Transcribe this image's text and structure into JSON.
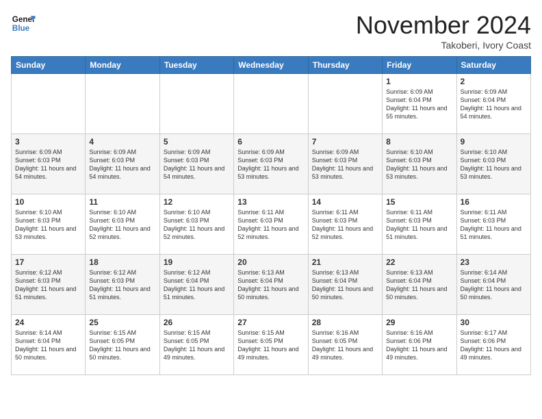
{
  "header": {
    "logo_line1": "General",
    "logo_line2": "Blue",
    "month": "November 2024",
    "location": "Takoberi, Ivory Coast"
  },
  "days_of_week": [
    "Sunday",
    "Monday",
    "Tuesday",
    "Wednesday",
    "Thursday",
    "Friday",
    "Saturday"
  ],
  "weeks": [
    [
      {
        "day": "",
        "info": ""
      },
      {
        "day": "",
        "info": ""
      },
      {
        "day": "",
        "info": ""
      },
      {
        "day": "",
        "info": ""
      },
      {
        "day": "",
        "info": ""
      },
      {
        "day": "1",
        "info": "Sunrise: 6:09 AM\nSunset: 6:04 PM\nDaylight: 11 hours and 55 minutes."
      },
      {
        "day": "2",
        "info": "Sunrise: 6:09 AM\nSunset: 6:04 PM\nDaylight: 11 hours and 54 minutes."
      }
    ],
    [
      {
        "day": "3",
        "info": "Sunrise: 6:09 AM\nSunset: 6:03 PM\nDaylight: 11 hours and 54 minutes."
      },
      {
        "day": "4",
        "info": "Sunrise: 6:09 AM\nSunset: 6:03 PM\nDaylight: 11 hours and 54 minutes."
      },
      {
        "day": "5",
        "info": "Sunrise: 6:09 AM\nSunset: 6:03 PM\nDaylight: 11 hours and 54 minutes."
      },
      {
        "day": "6",
        "info": "Sunrise: 6:09 AM\nSunset: 6:03 PM\nDaylight: 11 hours and 53 minutes."
      },
      {
        "day": "7",
        "info": "Sunrise: 6:09 AM\nSunset: 6:03 PM\nDaylight: 11 hours and 53 minutes."
      },
      {
        "day": "8",
        "info": "Sunrise: 6:10 AM\nSunset: 6:03 PM\nDaylight: 11 hours and 53 minutes."
      },
      {
        "day": "9",
        "info": "Sunrise: 6:10 AM\nSunset: 6:03 PM\nDaylight: 11 hours and 53 minutes."
      }
    ],
    [
      {
        "day": "10",
        "info": "Sunrise: 6:10 AM\nSunset: 6:03 PM\nDaylight: 11 hours and 53 minutes."
      },
      {
        "day": "11",
        "info": "Sunrise: 6:10 AM\nSunset: 6:03 PM\nDaylight: 11 hours and 52 minutes."
      },
      {
        "day": "12",
        "info": "Sunrise: 6:10 AM\nSunset: 6:03 PM\nDaylight: 11 hours and 52 minutes."
      },
      {
        "day": "13",
        "info": "Sunrise: 6:11 AM\nSunset: 6:03 PM\nDaylight: 11 hours and 52 minutes."
      },
      {
        "day": "14",
        "info": "Sunrise: 6:11 AM\nSunset: 6:03 PM\nDaylight: 11 hours and 52 minutes."
      },
      {
        "day": "15",
        "info": "Sunrise: 6:11 AM\nSunset: 6:03 PM\nDaylight: 11 hours and 51 minutes."
      },
      {
        "day": "16",
        "info": "Sunrise: 6:11 AM\nSunset: 6:03 PM\nDaylight: 11 hours and 51 minutes."
      }
    ],
    [
      {
        "day": "17",
        "info": "Sunrise: 6:12 AM\nSunset: 6:03 PM\nDaylight: 11 hours and 51 minutes."
      },
      {
        "day": "18",
        "info": "Sunrise: 6:12 AM\nSunset: 6:03 PM\nDaylight: 11 hours and 51 minutes."
      },
      {
        "day": "19",
        "info": "Sunrise: 6:12 AM\nSunset: 6:04 PM\nDaylight: 11 hours and 51 minutes."
      },
      {
        "day": "20",
        "info": "Sunrise: 6:13 AM\nSunset: 6:04 PM\nDaylight: 11 hours and 50 minutes."
      },
      {
        "day": "21",
        "info": "Sunrise: 6:13 AM\nSunset: 6:04 PM\nDaylight: 11 hours and 50 minutes."
      },
      {
        "day": "22",
        "info": "Sunrise: 6:13 AM\nSunset: 6:04 PM\nDaylight: 11 hours and 50 minutes."
      },
      {
        "day": "23",
        "info": "Sunrise: 6:14 AM\nSunset: 6:04 PM\nDaylight: 11 hours and 50 minutes."
      }
    ],
    [
      {
        "day": "24",
        "info": "Sunrise: 6:14 AM\nSunset: 6:04 PM\nDaylight: 11 hours and 50 minutes."
      },
      {
        "day": "25",
        "info": "Sunrise: 6:15 AM\nSunset: 6:05 PM\nDaylight: 11 hours and 50 minutes."
      },
      {
        "day": "26",
        "info": "Sunrise: 6:15 AM\nSunset: 6:05 PM\nDaylight: 11 hours and 49 minutes."
      },
      {
        "day": "27",
        "info": "Sunrise: 6:15 AM\nSunset: 6:05 PM\nDaylight: 11 hours and 49 minutes."
      },
      {
        "day": "28",
        "info": "Sunrise: 6:16 AM\nSunset: 6:05 PM\nDaylight: 11 hours and 49 minutes."
      },
      {
        "day": "29",
        "info": "Sunrise: 6:16 AM\nSunset: 6:06 PM\nDaylight: 11 hours and 49 minutes."
      },
      {
        "day": "30",
        "info": "Sunrise: 6:17 AM\nSunset: 6:06 PM\nDaylight: 11 hours and 49 minutes."
      }
    ]
  ]
}
